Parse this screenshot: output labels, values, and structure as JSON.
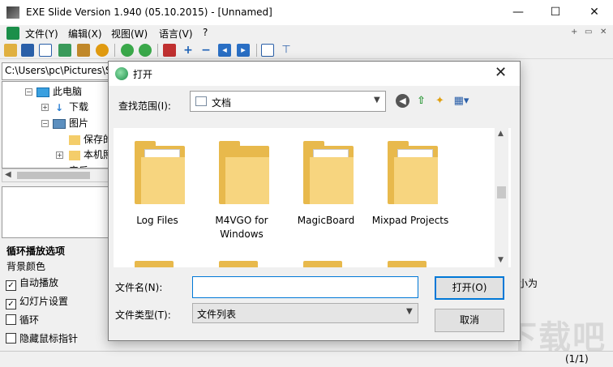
{
  "window": {
    "title": "EXE Slide Version 1.940 (05.10.2015) - [Unnamed]",
    "min_glyph": "—",
    "max_glyph": "☐",
    "close_glyph": "✕"
  },
  "menu": {
    "items": [
      "文件(Y)",
      "编辑(X)",
      "视图(W)",
      "语言(V)",
      "?"
    ],
    "mdi_buttons": [
      "+",
      "▭",
      "✕"
    ]
  },
  "toolbar": {
    "icons": [
      "open-icon",
      "save-icon",
      "window-icon",
      "image-icon",
      "image-edit-icon",
      "play-icon",
      "back-green-icon",
      "forward-green-icon",
      "pages-icon",
      "plus-icon",
      "minus-icon",
      "arrow-left-icon",
      "arrow-right-icon",
      "grid-icon",
      "pin-icon"
    ]
  },
  "sidebar": {
    "path": "C:\\Users\\pc\\Pictures\\S",
    "tree": [
      {
        "label": "此电脑",
        "icon": "computer-icon",
        "expander": "−"
      },
      {
        "label": "下载",
        "icon": "download-icon",
        "expander": "+"
      },
      {
        "label": "图片",
        "icon": "pictures-icon",
        "expander": "−"
      },
      {
        "label": "保存的",
        "icon": "folder-icon",
        "expander": ""
      },
      {
        "label": "本机照",
        "icon": "folder-icon",
        "expander": "+"
      },
      {
        "label": "音乐",
        "icon": "music-icon",
        "expander": "+"
      }
    ]
  },
  "options": {
    "title": "循环播放选项",
    "bg_color": "背景颜色",
    "items": [
      {
        "label": "自动播放",
        "checked": true
      },
      {
        "label": "幻灯片设置",
        "checked": true
      },
      {
        "label": "循环",
        "checked": false
      },
      {
        "label": "隐藏鼠标指针",
        "checked": false
      }
    ]
  },
  "main": {
    "size_label": "大小为",
    "page_count": "(1/1)",
    "watermark": "下载吧"
  },
  "dialog": {
    "title": "打开",
    "close_glyph": "✕",
    "look_in_label": "查找范围(I):",
    "look_in_value": "文档",
    "files": [
      "Log Files",
      "M4VGO for Windows",
      "MagicBoard",
      "Mixpad Projects"
    ],
    "filename_label": "文件名(N):",
    "filename_value": "",
    "filetype_label": "文件类型(T):",
    "filetype_value": "文件列表",
    "open_button": "打开(O)",
    "cancel_button": "取消"
  },
  "colors": {
    "accent": "#0078d7",
    "folder": "#f7d57f"
  }
}
